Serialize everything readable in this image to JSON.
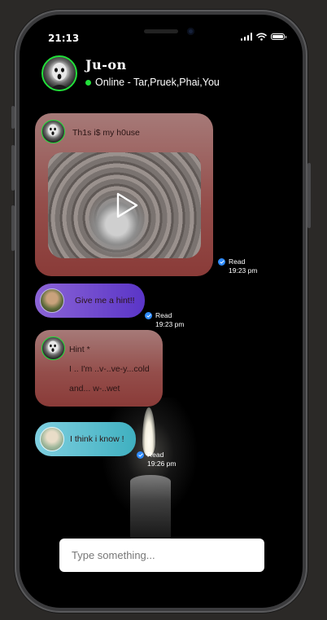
{
  "status_bar": {
    "time": "21:13",
    "signal_icon": "signal-icon",
    "wifi_icon": "wifi-icon",
    "battery_icon": "battery-icon"
  },
  "header": {
    "title": "Ju-on",
    "online_text": "Online - Tar,Pruek,Phai,You",
    "online_color": "#22e03a",
    "avatar_icon": "ghost-avatar"
  },
  "messages": [
    {
      "text": "Th1s i$ my h0use",
      "has_video": true,
      "read_label": "Read",
      "read_time": "19:23 pm"
    },
    {
      "text": "Give me a hint!!",
      "read_label": "Read",
      "read_time": "19:23 pm"
    },
    {
      "lines": [
        "Hint *",
        "I .. I'm ..v-..ve-y...cold",
        "and... w-..wet"
      ]
    },
    {
      "text": "I think i know !",
      "read_label": "Read",
      "read_time": "19:26 pm"
    }
  ],
  "composer": {
    "placeholder": "Type something..."
  },
  "colors": {
    "bubble_red": "#944e4b",
    "bubble_purple": "#5a35c7",
    "bubble_teal": "#3fb0c0",
    "read_check": "#2f8cff"
  }
}
